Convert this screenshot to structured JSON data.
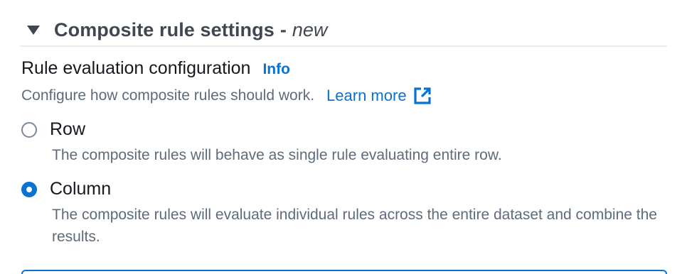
{
  "section": {
    "title": "Composite rule settings",
    "separator": "-",
    "badge": "new"
  },
  "field": {
    "label": "Rule evaluation configuration",
    "info_link": "Info",
    "description": "Configure how composite rules should work.",
    "learn_more": "Learn more"
  },
  "options": [
    {
      "label": "Row",
      "description": "The composite rules will behave as single rule evaluating entire row.",
      "checked": false
    },
    {
      "label": "Column",
      "description": "The composite rules will evaluate individual rules across the entire dataset and combine the results.",
      "checked": true
    }
  ],
  "colors": {
    "accent": "#0972d3",
    "text": "#16191f",
    "secondary_text": "#5f6b7a",
    "header_text": "#414750"
  },
  "icons": {
    "expand": "caret-down-icon",
    "external": "external-link-icon"
  }
}
